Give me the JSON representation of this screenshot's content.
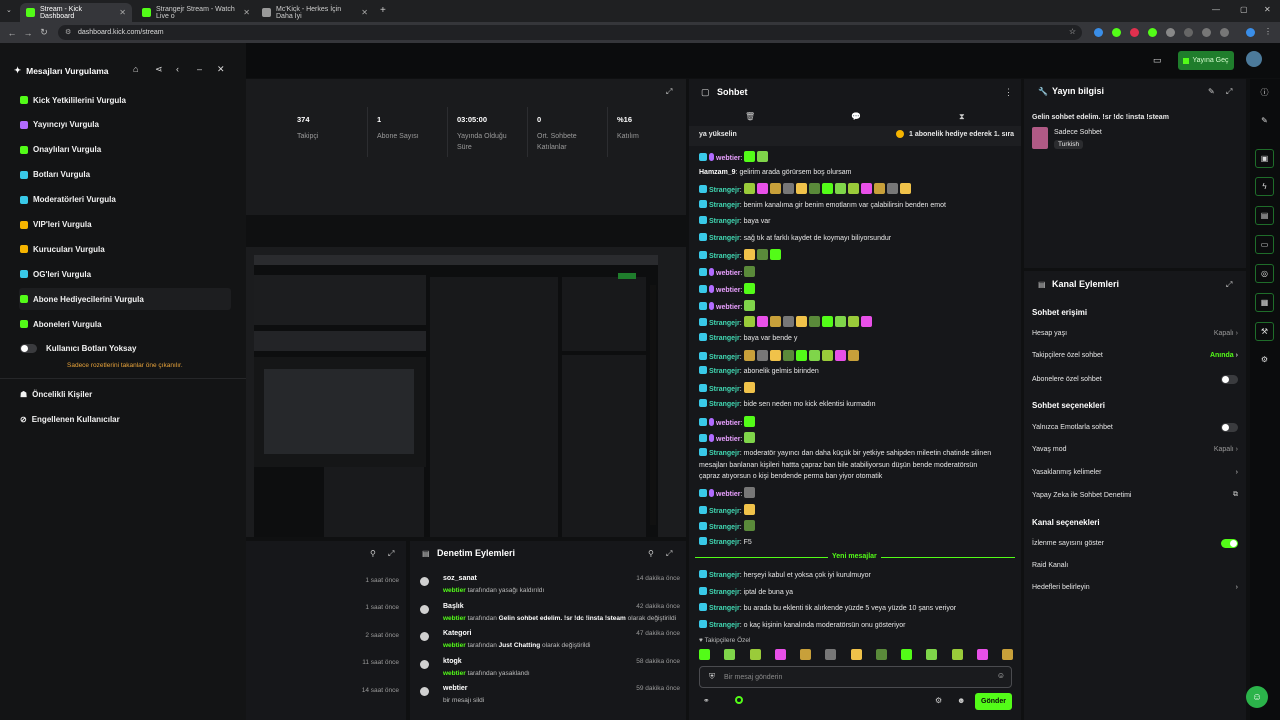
{
  "browser": {
    "tabs": [
      {
        "title": "Stream - Kick Dashboard"
      },
      {
        "title": "Strangejr Stream - Watch Live o"
      },
      {
        "title": "Mc'Kick - Herkes İçin Daha İyi"
      }
    ],
    "url": "dashboard.kick.com/stream"
  },
  "header": {
    "go_live_label": "Yayına Geç"
  },
  "highlight_panel": {
    "title": "Mesajları Vurgulama",
    "items": [
      {
        "label": "Kick Yetkililerini Vurgula",
        "icon": "kick-staff-icon",
        "color": "#53fc18"
      },
      {
        "label": "Yayıncıyı Vurgula",
        "icon": "broadcaster-icon",
        "color": "#b16bff"
      },
      {
        "label": "Onaylıları Vurgula",
        "icon": "verified-icon",
        "color": "#53fc18"
      },
      {
        "label": "Botları Vurgula",
        "icon": "bot-icon",
        "color": "#39c9e8"
      },
      {
        "label": "Moderatörleri Vurgula",
        "icon": "moderator-icon",
        "color": "#39c9e8"
      },
      {
        "label": "VIP'leri Vurgula",
        "icon": "vip-icon",
        "color": "#f5b400"
      },
      {
        "label": "Kurucuları Vurgula",
        "icon": "founder-icon",
        "color": "#f5b400"
      },
      {
        "label": "OG'leri Vurgula",
        "icon": "og-icon",
        "color": "#39c9e8"
      },
      {
        "label": "Abone Hediyecilerini Vurgula",
        "icon": "gifter-icon",
        "color": "#53fc18"
      },
      {
        "label": "Aboneleri Vurgula",
        "icon": "subscriber-icon",
        "color": "#53fc18"
      }
    ],
    "ignore_bots_label": "Kullanıcı Botları Yoksay",
    "note": "Sadece rozetlerini takanlar öne çıkanılır.",
    "priority_label": "Öncelikli Kişiler",
    "blocked_label": "Engellenen Kullanıcılar"
  },
  "stats": [
    {
      "value": "374",
      "label": "Takipçi"
    },
    {
      "value": "1",
      "label": "Abone Sayısı"
    },
    {
      "value": "03:05:00",
      "label": "Yayında Olduğu Süre"
    },
    {
      "value": "0",
      "label": "Ort. Sohbete Katılanlar"
    },
    {
      "value": "%16",
      "label": "Katılım"
    }
  ],
  "activity": {
    "times": [
      "1 saat önce",
      "1 saat önce",
      "2 saat önce",
      "11 saat önce",
      "14 saat önce"
    ]
  },
  "moderation": {
    "title": "Denetim Eylemleri",
    "items": [
      {
        "title": "soz_sanat",
        "time": "14 dakika önce",
        "user": "webtier",
        "desc": "tarafından yasağı kaldırıldı"
      },
      {
        "title": "Başlık",
        "time": "42 dakika önce",
        "user": "webtier",
        "desc": "tarafından",
        "highlight": "Gelin sohbet edelim. !sr !dc !insta !steam",
        "desc2": "olarak değiştirildi"
      },
      {
        "title": "Kategori",
        "time": "47 dakika önce",
        "user": "webtier",
        "desc": "tarafından",
        "highlight": "Just Chatting",
        "desc2": "olarak değiştirildi"
      },
      {
        "title": "ktogk",
        "time": "58 dakika önce",
        "user": "webtier",
        "desc": "tarafından yasaklandı"
      },
      {
        "title": "webtier",
        "time": "59 dakika önce",
        "user": "",
        "desc": "bir mesajı sildi"
      }
    ]
  },
  "chat": {
    "title": "Sohbet",
    "pinned_left": "ya yükselin",
    "pinned_right": "1 abonelik hediye ederek 1. sıra",
    "messages": [
      {
        "user": "webtier",
        "text": "",
        "type": "w"
      },
      {
        "user": "Hamzam_9",
        "text": "gelirim arada görürsem boş olursam",
        "type": "plain"
      },
      {
        "user": "Strangejr",
        "text": "",
        "type": "s"
      },
      {
        "user": "Strangejr",
        "text": "benim kanalıma gir benim emotlarım var çalabilirsin benden emot",
        "type": "s"
      },
      {
        "user": "Strangejr",
        "text": "baya var",
        "type": "s"
      },
      {
        "user": "Strangejr",
        "text": "sağ tık at farklı kaydet de koymayı biliyorsundur",
        "type": "s"
      },
      {
        "user": "Strangejr",
        "text": "",
        "type": "s"
      },
      {
        "user": "webtier",
        "text": "",
        "type": "w"
      },
      {
        "user": "webtier",
        "text": "",
        "type": "w"
      },
      {
        "user": "webtier",
        "text": "",
        "type": "w"
      },
      {
        "user": "Strangejr",
        "text": "",
        "type": "s"
      },
      {
        "user": "Strangejr",
        "text": "baya var bende y",
        "type": "s"
      },
      {
        "user": "Strangejr",
        "text": "",
        "type": "s"
      },
      {
        "user": "Strangejr",
        "text": "abonelik gelmis birinden",
        "type": "s"
      },
      {
        "user": "Strangejr",
        "text": "",
        "type": "s"
      },
      {
        "user": "Strangejr",
        "text": "bide sen neden mo kick eklentisi kurmadın",
        "type": "s"
      },
      {
        "user": "webtier",
        "text": "",
        "type": "w"
      },
      {
        "user": "webtier",
        "text": "",
        "type": "w"
      },
      {
        "user": "Strangejr",
        "text": "moderatör yayıncı dan daha küçük bir yetkiye sahipden mileetin chatinde silinen",
        "type": "s"
      },
      {
        "user": "",
        "text": "mesajları banlanan kişileri hattta çapraz ban bile atabiliyorsun düşün bende moderatörsün",
        "type": "cont"
      },
      {
        "user": "",
        "text": "çapraz atıyorsun o kişi bendende perma ban yiyor otomatik",
        "type": "cont"
      },
      {
        "user": "webtier",
        "text": "",
        "type": "w"
      },
      {
        "user": "Strangejr",
        "text": "",
        "type": "s"
      },
      {
        "user": "Strangejr",
        "text": "",
        "type": "s"
      },
      {
        "user": "Strangejr",
        "text": "F5",
        "type": "s"
      }
    ],
    "new_messages_label": "Yeni mesajlar",
    "new_messages": [
      {
        "user": "Strangejr",
        "text": "herşeyi kabul et yoksa çok iyi kurulmuyor"
      },
      {
        "user": "Strangejr",
        "text": "iptal de buna ya"
      },
      {
        "user": "Strangejr",
        "text": "bu arada bu eklenti tik alırkende yüzde 5 veya yüzde 10 şans veriyor"
      },
      {
        "user": "Strangejr",
        "text": "o kaç kişinin kanalında moderatörsün onu gösteriyor"
      }
    ],
    "followers_only_label": "Takipçilere Özel",
    "input_placeholder": "Bir mesaj gönderin",
    "send_label": "Gönder"
  },
  "stream_info": {
    "title": "Yayın bilgisi",
    "stream_title": "Gelin sohbet edelim. !sr !dc !insta !steam",
    "category": "Sadece Sohbet",
    "language": "Turkish"
  },
  "channel_actions": {
    "title": "Kanal Eylemleri",
    "chat_access_title": "Sohbet erişimi",
    "account_age_label": "Hesap yaşı",
    "account_age_value": "Kapalı",
    "followers_only_label": "Takipçilere özel sohbet",
    "followers_only_value": "Anında",
    "subscribers_only_label": "Abonelere özel sohbet",
    "chat_options_title": "Sohbet seçenekleri",
    "emote_only_label": "Yalnızca Emotlarla sohbet",
    "slow_mode_label": "Yavaş mod",
    "slow_mode_value": "Kapalı",
    "banned_words_label": "Yasaklanmış kelimeler",
    "ai_moderation_label": "Yapay Zeka ile Sohbet Denetimi",
    "channel_options_title": "Kanal seçenekleri",
    "show_viewers_label": "İzlenme sayısını göster",
    "raid_label": "Raid Kanalı",
    "goals_label": "Hedefleri belirleyin"
  },
  "colors": {
    "accent": "#53fc18",
    "bg": "#0f1011",
    "panel": "#16171a"
  }
}
